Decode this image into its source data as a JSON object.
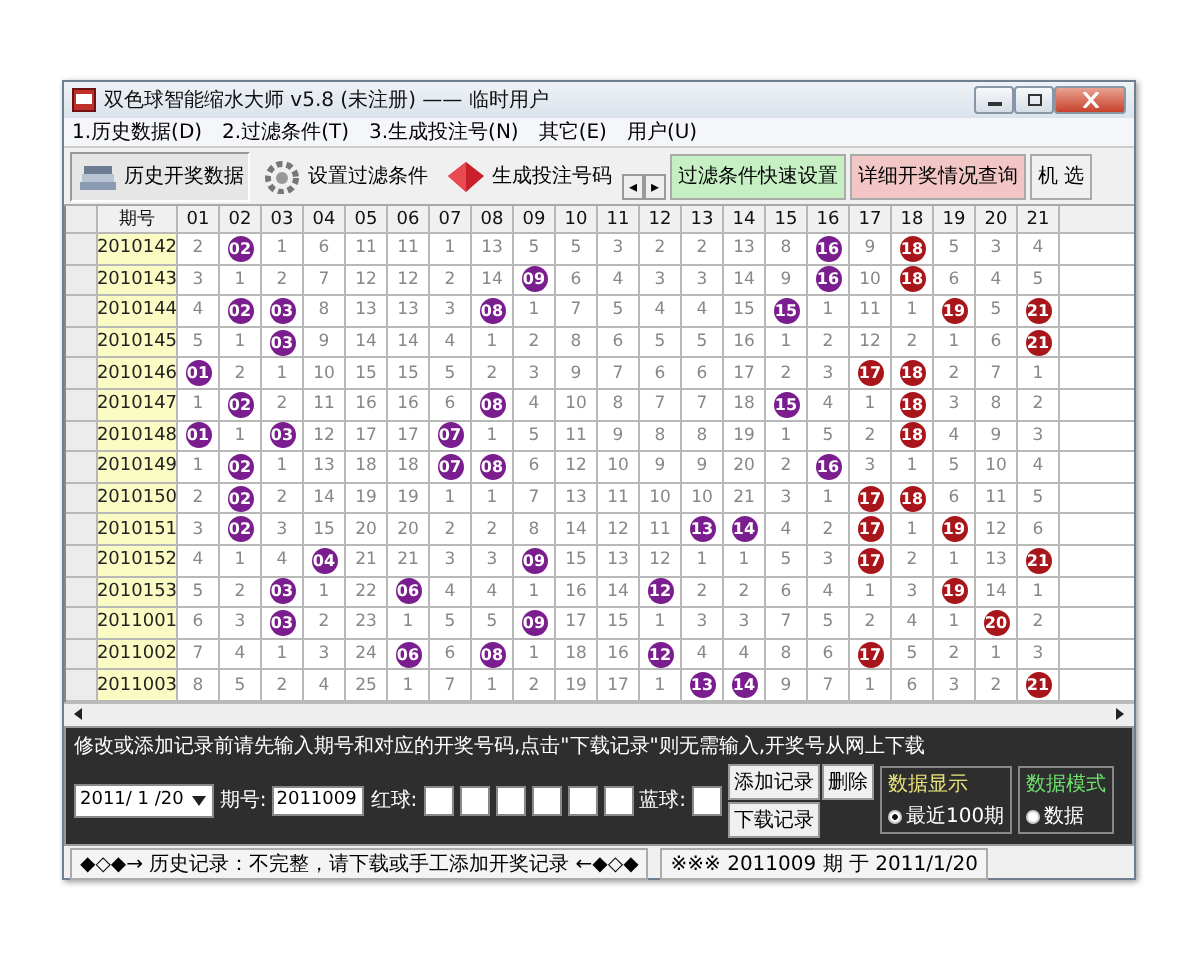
{
  "window": {
    "title": "双色球智能缩水大师 v5.8  (未注册)  —— 临时用户"
  },
  "menu": [
    "1.历史数据(D)",
    "2.过滤条件(T)",
    "3.生成投注号(N)",
    "其它(E)",
    "用户(U)"
  ],
  "toolbar": {
    "tabs": [
      {
        "label": "历史开奖数据",
        "selected": true,
        "kind": "books"
      },
      {
        "label": "设置过滤条件",
        "selected": false,
        "kind": "gear"
      },
      {
        "label": "生成投注号码",
        "selected": false,
        "kind": "gem"
      }
    ],
    "arrows": [
      "◂",
      "▸"
    ],
    "buttons": [
      {
        "label": "过滤条件快速设置",
        "kind": "green"
      },
      {
        "label": "详细开奖情况查询",
        "kind": "pink"
      },
      {
        "label": "机 选",
        "kind": "plain"
      }
    ]
  },
  "table": {
    "corner": "期号",
    "columns": [
      {
        "label": "01",
        "kind": "lower"
      },
      {
        "label": "02",
        "kind": "lower"
      },
      {
        "label": "03",
        "kind": "lower"
      },
      {
        "label": "04",
        "kind": "lower"
      },
      {
        "label": "05",
        "kind": "lower"
      },
      {
        "label": "06",
        "kind": "lower"
      },
      {
        "label": "07",
        "kind": "lower"
      },
      {
        "label": "08",
        "kind": "lower"
      },
      {
        "label": "09",
        "kind": "lower"
      },
      {
        "label": "10",
        "kind": "lower"
      },
      {
        "label": "11",
        "kind": "lower"
      },
      {
        "label": "12",
        "kind": "lower"
      },
      {
        "label": "13",
        "kind": "lower"
      },
      {
        "label": "14",
        "kind": "lower"
      },
      {
        "label": "15",
        "kind": "lower"
      },
      {
        "label": "16",
        "kind": "lower"
      },
      {
        "label": "17",
        "kind": "upper"
      },
      {
        "label": "18",
        "kind": "upper"
      },
      {
        "label": "19",
        "kind": "upper"
      },
      {
        "label": "20",
        "kind": "upper"
      },
      {
        "label": "21",
        "kind": "upper"
      }
    ],
    "rows": [
      {
        "issue": "2010142",
        "cells": [
          {
            "text": "2",
            "hit": false
          },
          {
            "text": "02",
            "hit": true
          },
          {
            "text": "1",
            "hit": false
          },
          {
            "text": "6",
            "hit": false
          },
          {
            "text": "11",
            "hit": false
          },
          {
            "text": "11",
            "hit": false
          },
          {
            "text": "1",
            "hit": false
          },
          {
            "text": "13",
            "hit": false
          },
          {
            "text": "5",
            "hit": false
          },
          {
            "text": "5",
            "hit": false
          },
          {
            "text": "3",
            "hit": false
          },
          {
            "text": "2",
            "hit": false
          },
          {
            "text": "2",
            "hit": false
          },
          {
            "text": "13",
            "hit": false
          },
          {
            "text": "8",
            "hit": false
          },
          {
            "text": "16",
            "hit": true
          },
          {
            "text": "9",
            "hit": false
          },
          {
            "text": "18",
            "hit": true
          },
          {
            "text": "5",
            "hit": false
          },
          {
            "text": "3",
            "hit": false
          },
          {
            "text": "4",
            "hit": false
          }
        ]
      },
      {
        "issue": "2010143",
        "cells": [
          {
            "text": "3",
            "hit": false
          },
          {
            "text": "1",
            "hit": false
          },
          {
            "text": "2",
            "hit": false
          },
          {
            "text": "7",
            "hit": false
          },
          {
            "text": "12",
            "hit": false
          },
          {
            "text": "12",
            "hit": false
          },
          {
            "text": "2",
            "hit": false
          },
          {
            "text": "14",
            "hit": false
          },
          {
            "text": "09",
            "hit": true
          },
          {
            "text": "6",
            "hit": false
          },
          {
            "text": "4",
            "hit": false
          },
          {
            "text": "3",
            "hit": false
          },
          {
            "text": "3",
            "hit": false
          },
          {
            "text": "14",
            "hit": false
          },
          {
            "text": "9",
            "hit": false
          },
          {
            "text": "16",
            "hit": true
          },
          {
            "text": "10",
            "hit": false
          },
          {
            "text": "18",
            "hit": true
          },
          {
            "text": "6",
            "hit": false
          },
          {
            "text": "4",
            "hit": false
          },
          {
            "text": "5",
            "hit": false
          }
        ]
      },
      {
        "issue": "2010144",
        "cells": [
          {
            "text": "4",
            "hit": false
          },
          {
            "text": "02",
            "hit": true
          },
          {
            "text": "03",
            "hit": true
          },
          {
            "text": "8",
            "hit": false
          },
          {
            "text": "13",
            "hit": false
          },
          {
            "text": "13",
            "hit": false
          },
          {
            "text": "3",
            "hit": false
          },
          {
            "text": "08",
            "hit": true
          },
          {
            "text": "1",
            "hit": false
          },
          {
            "text": "7",
            "hit": false
          },
          {
            "text": "5",
            "hit": false
          },
          {
            "text": "4",
            "hit": false
          },
          {
            "text": "4",
            "hit": false
          },
          {
            "text": "15",
            "hit": false
          },
          {
            "text": "15",
            "hit": true
          },
          {
            "text": "1",
            "hit": false
          },
          {
            "text": "11",
            "hit": false
          },
          {
            "text": "1",
            "hit": false
          },
          {
            "text": "19",
            "hit": true
          },
          {
            "text": "5",
            "hit": false
          },
          {
            "text": "21",
            "hit": true
          }
        ]
      },
      {
        "issue": "2010145",
        "cells": [
          {
            "text": "5",
            "hit": false
          },
          {
            "text": "1",
            "hit": false
          },
          {
            "text": "03",
            "hit": true
          },
          {
            "text": "9",
            "hit": false
          },
          {
            "text": "14",
            "hit": false
          },
          {
            "text": "14",
            "hit": false
          },
          {
            "text": "4",
            "hit": false
          },
          {
            "text": "1",
            "hit": false
          },
          {
            "text": "2",
            "hit": false
          },
          {
            "text": "8",
            "hit": false
          },
          {
            "text": "6",
            "hit": false
          },
          {
            "text": "5",
            "hit": false
          },
          {
            "text": "5",
            "hit": false
          },
          {
            "text": "16",
            "hit": false
          },
          {
            "text": "1",
            "hit": false
          },
          {
            "text": "2",
            "hit": false
          },
          {
            "text": "12",
            "hit": false
          },
          {
            "text": "2",
            "hit": false
          },
          {
            "text": "1",
            "hit": false
          },
          {
            "text": "6",
            "hit": false
          },
          {
            "text": "21",
            "hit": true
          }
        ]
      },
      {
        "issue": "2010146",
        "cells": [
          {
            "text": "01",
            "hit": true
          },
          {
            "text": "2",
            "hit": false
          },
          {
            "text": "1",
            "hit": false
          },
          {
            "text": "10",
            "hit": false
          },
          {
            "text": "15",
            "hit": false
          },
          {
            "text": "15",
            "hit": false
          },
          {
            "text": "5",
            "hit": false
          },
          {
            "text": "2",
            "hit": false
          },
          {
            "text": "3",
            "hit": false
          },
          {
            "text": "9",
            "hit": false
          },
          {
            "text": "7",
            "hit": false
          },
          {
            "text": "6",
            "hit": false
          },
          {
            "text": "6",
            "hit": false
          },
          {
            "text": "17",
            "hit": false
          },
          {
            "text": "2",
            "hit": false
          },
          {
            "text": "3",
            "hit": false
          },
          {
            "text": "17",
            "hit": true
          },
          {
            "text": "18",
            "hit": true
          },
          {
            "text": "2",
            "hit": false
          },
          {
            "text": "7",
            "hit": false
          },
          {
            "text": "1",
            "hit": false
          }
        ]
      },
      {
        "issue": "2010147",
        "cells": [
          {
            "text": "1",
            "hit": false
          },
          {
            "text": "02",
            "hit": true
          },
          {
            "text": "2",
            "hit": false
          },
          {
            "text": "11",
            "hit": false
          },
          {
            "text": "16",
            "hit": false
          },
          {
            "text": "16",
            "hit": false
          },
          {
            "text": "6",
            "hit": false
          },
          {
            "text": "08",
            "hit": true
          },
          {
            "text": "4",
            "hit": false
          },
          {
            "text": "10",
            "hit": false
          },
          {
            "text": "8",
            "hit": false
          },
          {
            "text": "7",
            "hit": false
          },
          {
            "text": "7",
            "hit": false
          },
          {
            "text": "18",
            "hit": false
          },
          {
            "text": "15",
            "hit": true
          },
          {
            "text": "4",
            "hit": false
          },
          {
            "text": "1",
            "hit": false
          },
          {
            "text": "18",
            "hit": true
          },
          {
            "text": "3",
            "hit": false
          },
          {
            "text": "8",
            "hit": false
          },
          {
            "text": "2",
            "hit": false
          }
        ]
      },
      {
        "issue": "2010148",
        "cells": [
          {
            "text": "01",
            "hit": true
          },
          {
            "text": "1",
            "hit": false
          },
          {
            "text": "03",
            "hit": true
          },
          {
            "text": "12",
            "hit": false
          },
          {
            "text": "17",
            "hit": false
          },
          {
            "text": "17",
            "hit": false
          },
          {
            "text": "07",
            "hit": true
          },
          {
            "text": "1",
            "hit": false
          },
          {
            "text": "5",
            "hit": false
          },
          {
            "text": "11",
            "hit": false
          },
          {
            "text": "9",
            "hit": false
          },
          {
            "text": "8",
            "hit": false
          },
          {
            "text": "8",
            "hit": false
          },
          {
            "text": "19",
            "hit": false
          },
          {
            "text": "1",
            "hit": false
          },
          {
            "text": "5",
            "hit": false
          },
          {
            "text": "2",
            "hit": false
          },
          {
            "text": "18",
            "hit": true
          },
          {
            "text": "4",
            "hit": false
          },
          {
            "text": "9",
            "hit": false
          },
          {
            "text": "3",
            "hit": false
          }
        ]
      },
      {
        "issue": "2010149",
        "cells": [
          {
            "text": "1",
            "hit": false
          },
          {
            "text": "02",
            "hit": true
          },
          {
            "text": "1",
            "hit": false
          },
          {
            "text": "13",
            "hit": false
          },
          {
            "text": "18",
            "hit": false
          },
          {
            "text": "18",
            "hit": false
          },
          {
            "text": "07",
            "hit": true
          },
          {
            "text": "08",
            "hit": true
          },
          {
            "text": "6",
            "hit": false
          },
          {
            "text": "12",
            "hit": false
          },
          {
            "text": "10",
            "hit": false
          },
          {
            "text": "9",
            "hit": false
          },
          {
            "text": "9",
            "hit": false
          },
          {
            "text": "20",
            "hit": false
          },
          {
            "text": "2",
            "hit": false
          },
          {
            "text": "16",
            "hit": true
          },
          {
            "text": "3",
            "hit": false
          },
          {
            "text": "1",
            "hit": false
          },
          {
            "text": "5",
            "hit": false
          },
          {
            "text": "10",
            "hit": false
          },
          {
            "text": "4",
            "hit": false
          }
        ]
      },
      {
        "issue": "2010150",
        "cells": [
          {
            "text": "2",
            "hit": false
          },
          {
            "text": "02",
            "hit": true
          },
          {
            "text": "2",
            "hit": false
          },
          {
            "text": "14",
            "hit": false
          },
          {
            "text": "19",
            "hit": false
          },
          {
            "text": "19",
            "hit": false
          },
          {
            "text": "1",
            "hit": false
          },
          {
            "text": "1",
            "hit": false
          },
          {
            "text": "7",
            "hit": false
          },
          {
            "text": "13",
            "hit": false
          },
          {
            "text": "11",
            "hit": false
          },
          {
            "text": "10",
            "hit": false
          },
          {
            "text": "10",
            "hit": false
          },
          {
            "text": "21",
            "hit": false
          },
          {
            "text": "3",
            "hit": false
          },
          {
            "text": "1",
            "hit": false
          },
          {
            "text": "17",
            "hit": true
          },
          {
            "text": "18",
            "hit": true
          },
          {
            "text": "6",
            "hit": false
          },
          {
            "text": "11",
            "hit": false
          },
          {
            "text": "5",
            "hit": false
          }
        ]
      },
      {
        "issue": "2010151",
        "cells": [
          {
            "text": "3",
            "hit": false
          },
          {
            "text": "02",
            "hit": true
          },
          {
            "text": "3",
            "hit": false
          },
          {
            "text": "15",
            "hit": false
          },
          {
            "text": "20",
            "hit": false
          },
          {
            "text": "20",
            "hit": false
          },
          {
            "text": "2",
            "hit": false
          },
          {
            "text": "2",
            "hit": false
          },
          {
            "text": "8",
            "hit": false
          },
          {
            "text": "14",
            "hit": false
          },
          {
            "text": "12",
            "hit": false
          },
          {
            "text": "11",
            "hit": false
          },
          {
            "text": "13",
            "hit": true
          },
          {
            "text": "14",
            "hit": true
          },
          {
            "text": "4",
            "hit": false
          },
          {
            "text": "2",
            "hit": false
          },
          {
            "text": "17",
            "hit": true
          },
          {
            "text": "1",
            "hit": false
          },
          {
            "text": "19",
            "hit": true
          },
          {
            "text": "12",
            "hit": false
          },
          {
            "text": "6",
            "hit": false
          }
        ]
      },
      {
        "issue": "2010152",
        "cells": [
          {
            "text": "4",
            "hit": false
          },
          {
            "text": "1",
            "hit": false
          },
          {
            "text": "4",
            "hit": false
          },
          {
            "text": "04",
            "hit": true
          },
          {
            "text": "21",
            "hit": false
          },
          {
            "text": "21",
            "hit": false
          },
          {
            "text": "3",
            "hit": false
          },
          {
            "text": "3",
            "hit": false
          },
          {
            "text": "09",
            "hit": true
          },
          {
            "text": "15",
            "hit": false
          },
          {
            "text": "13",
            "hit": false
          },
          {
            "text": "12",
            "hit": false
          },
          {
            "text": "1",
            "hit": false
          },
          {
            "text": "1",
            "hit": false
          },
          {
            "text": "5",
            "hit": false
          },
          {
            "text": "3",
            "hit": false
          },
          {
            "text": "17",
            "hit": true
          },
          {
            "text": "2",
            "hit": false
          },
          {
            "text": "1",
            "hit": false
          },
          {
            "text": "13",
            "hit": false
          },
          {
            "text": "21",
            "hit": true
          }
        ]
      },
      {
        "issue": "2010153",
        "cells": [
          {
            "text": "5",
            "hit": false
          },
          {
            "text": "2",
            "hit": false
          },
          {
            "text": "03",
            "hit": true
          },
          {
            "text": "1",
            "hit": false
          },
          {
            "text": "22",
            "hit": false
          },
          {
            "text": "06",
            "hit": true
          },
          {
            "text": "4",
            "hit": false
          },
          {
            "text": "4",
            "hit": false
          },
          {
            "text": "1",
            "hit": false
          },
          {
            "text": "16",
            "hit": false
          },
          {
            "text": "14",
            "hit": false
          },
          {
            "text": "12",
            "hit": true
          },
          {
            "text": "2",
            "hit": false
          },
          {
            "text": "2",
            "hit": false
          },
          {
            "text": "6",
            "hit": false
          },
          {
            "text": "4",
            "hit": false
          },
          {
            "text": "1",
            "hit": false
          },
          {
            "text": "3",
            "hit": false
          },
          {
            "text": "19",
            "hit": true
          },
          {
            "text": "14",
            "hit": false
          },
          {
            "text": "1",
            "hit": false
          }
        ]
      },
      {
        "issue": "2011001",
        "cells": [
          {
            "text": "6",
            "hit": false
          },
          {
            "text": "3",
            "hit": false
          },
          {
            "text": "03",
            "hit": true
          },
          {
            "text": "2",
            "hit": false
          },
          {
            "text": "23",
            "hit": false
          },
          {
            "text": "1",
            "hit": false
          },
          {
            "text": "5",
            "hit": false
          },
          {
            "text": "5",
            "hit": false
          },
          {
            "text": "09",
            "hit": true
          },
          {
            "text": "17",
            "hit": false
          },
          {
            "text": "15",
            "hit": false
          },
          {
            "text": "1",
            "hit": false
          },
          {
            "text": "3",
            "hit": false
          },
          {
            "text": "3",
            "hit": false
          },
          {
            "text": "7",
            "hit": false
          },
          {
            "text": "5",
            "hit": false
          },
          {
            "text": "2",
            "hit": false
          },
          {
            "text": "4",
            "hit": false
          },
          {
            "text": "1",
            "hit": false
          },
          {
            "text": "20",
            "hit": true
          },
          {
            "text": "2",
            "hit": false
          }
        ]
      },
      {
        "issue": "2011002",
        "cells": [
          {
            "text": "7",
            "hit": false
          },
          {
            "text": "4",
            "hit": false
          },
          {
            "text": "1",
            "hit": false
          },
          {
            "text": "3",
            "hit": false
          },
          {
            "text": "24",
            "hit": false
          },
          {
            "text": "06",
            "hit": true
          },
          {
            "text": "6",
            "hit": false
          },
          {
            "text": "08",
            "hit": true
          },
          {
            "text": "1",
            "hit": false
          },
          {
            "text": "18",
            "hit": false
          },
          {
            "text": "16",
            "hit": false
          },
          {
            "text": "12",
            "hit": true
          },
          {
            "text": "4",
            "hit": false
          },
          {
            "text": "4",
            "hit": false
          },
          {
            "text": "8",
            "hit": false
          },
          {
            "text": "6",
            "hit": false
          },
          {
            "text": "17",
            "hit": true
          },
          {
            "text": "5",
            "hit": false
          },
          {
            "text": "2",
            "hit": false
          },
          {
            "text": "1",
            "hit": false
          },
          {
            "text": "3",
            "hit": false
          }
        ]
      },
      {
        "issue": "2011003",
        "cells": [
          {
            "text": "8",
            "hit": false
          },
          {
            "text": "5",
            "hit": false
          },
          {
            "text": "2",
            "hit": false
          },
          {
            "text": "4",
            "hit": false
          },
          {
            "text": "25",
            "hit": false
          },
          {
            "text": "1",
            "hit": false
          },
          {
            "text": "7",
            "hit": false
          },
          {
            "text": "1",
            "hit": false
          },
          {
            "text": "2",
            "hit": false
          },
          {
            "text": "19",
            "hit": false
          },
          {
            "text": "17",
            "hit": false
          },
          {
            "text": "1",
            "hit": false
          },
          {
            "text": "13",
            "hit": true
          },
          {
            "text": "14",
            "hit": true
          },
          {
            "text": "9",
            "hit": false
          },
          {
            "text": "7",
            "hit": false
          },
          {
            "text": "1",
            "hit": false
          },
          {
            "text": "6",
            "hit": false
          },
          {
            "text": "3",
            "hit": false
          },
          {
            "text": "2",
            "hit": false
          },
          {
            "text": "21",
            "hit": true
          }
        ]
      }
    ]
  },
  "entry": {
    "hint": "修改或添加记录前请先输入期号和对应的开奖号码,点击\"下载记录\"则无需输入,开奖号从网上下载",
    "date": "2011/ 1 /20",
    "issue_label": "期号:",
    "issue_value": "2011009",
    "red_label": "红球:",
    "blue_label": "蓝球:",
    "buttons": [
      "添加记录",
      "删除",
      "下载记录"
    ]
  },
  "display_group": {
    "title": "数据显示",
    "options": [
      {
        "label": "最近100期",
        "selected": true
      }
    ]
  },
  "mode_group": {
    "title": "数据模式",
    "options": [
      {
        "label": "数据",
        "selected": false
      }
    ]
  },
  "status_bar": [
    "◆◇◆→ 历史记录：不完整，请下载或手工添加开奖记录 ←◆◇◆",
    "※※※ 2011009 期 于 2011/1/20"
  ]
}
